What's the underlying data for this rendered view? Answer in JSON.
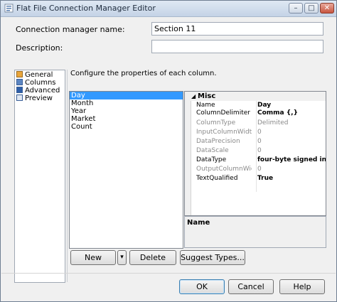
{
  "window": {
    "title": "Flat File Connection Manager Editor",
    "min": "–",
    "max": "□",
    "close": "✕"
  },
  "form": {
    "name_label": "Connection manager name:",
    "name_value": "Section 11",
    "description_label": "Description:",
    "description_value": ""
  },
  "nav": {
    "items": [
      "General",
      "Columns",
      "Advanced",
      "Preview"
    ],
    "selected": "Advanced"
  },
  "main": {
    "instruction": "Configure the properties of each column.",
    "columns": [
      "Day",
      "Month",
      "Year",
      "Market",
      "Count"
    ],
    "selected_column": "Day"
  },
  "properties": {
    "category": "Misc",
    "rows": [
      {
        "name": "Name",
        "value": "Day",
        "readonly": false,
        "bold": true
      },
      {
        "name": "ColumnDelimiter",
        "value": "Comma {,}",
        "readonly": false,
        "bold": true
      },
      {
        "name": "ColumnType",
        "value": "Delimited",
        "readonly": true,
        "bold": false
      },
      {
        "name": "InputColumnWidth",
        "value": "0",
        "readonly": true,
        "bold": false
      },
      {
        "name": "DataPrecision",
        "value": "0",
        "readonly": true,
        "bold": false
      },
      {
        "name": "DataScale",
        "value": "0",
        "readonly": true,
        "bold": false
      },
      {
        "name": "DataType",
        "value": "four-byte signed integer [DT",
        "readonly": false,
        "bold": true
      },
      {
        "name": "OutputColumnWidth",
        "value": "0",
        "readonly": true,
        "bold": false
      },
      {
        "name": "TextQualified",
        "value": "True",
        "readonly": false,
        "bold": true
      }
    ],
    "description_title": "Name"
  },
  "buttons": {
    "new": "New",
    "new_dropdown": "▾",
    "delete": "Delete",
    "suggest": "Suggest Types...",
    "ok": "OK",
    "cancel": "Cancel",
    "help": "Help"
  },
  "colors": {
    "selection": "#3399ff",
    "titlebar": "#c4d3e6"
  }
}
